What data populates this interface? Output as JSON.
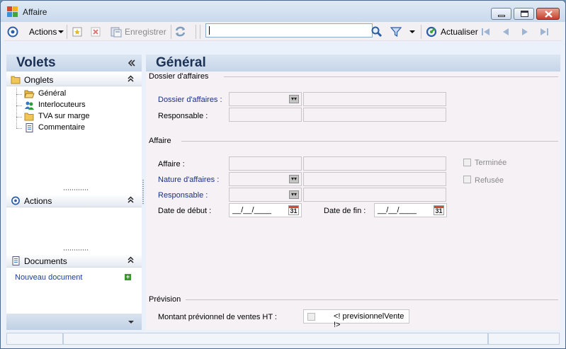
{
  "window": {
    "title": "Affaire",
    "accent": "#1c3254",
    "close_color": "#c7402a"
  },
  "toolbar": {
    "actions_label": "Actions",
    "save_label": "Enregistrer",
    "search_value": "",
    "refresh_label": "Actualiser"
  },
  "left_pane": {
    "title": "Volets",
    "tabs_section": {
      "title": "Onglets",
      "items": [
        {
          "label": "Général",
          "icon": "folder-open-icon"
        },
        {
          "label": "Interlocuteurs",
          "icon": "people-icon"
        },
        {
          "label": "TVA sur marge",
          "icon": "folder-icon"
        },
        {
          "label": "Commentaire",
          "icon": "document-icon"
        }
      ]
    },
    "actions_section": {
      "title": "Actions"
    },
    "documents_section": {
      "title": "Documents",
      "new_document_label": "Nouveau document"
    }
  },
  "main": {
    "title": "Général",
    "dossier_group": {
      "title": "Dossier d'affaires",
      "dossier_label": "Dossier d'affaires :",
      "responsable_label": "Responsable :"
    },
    "affaire_group": {
      "title": "Affaire",
      "affaire_label": "Affaire :",
      "nature_label": "Nature d'affaires :",
      "responsable_label": "Responsable :",
      "date_debut_label": "Date de début :",
      "date_debut_value": "__/__/____",
      "date_fin_label": "Date de fin :",
      "date_fin_value": "__/__/____",
      "calendar_day": "31",
      "terminee_label": "Terminée",
      "refusee_label": "Refusée"
    },
    "prevision_group": {
      "title": "Prévision",
      "montant_label": "Montant prévionnel de ventes HT :",
      "montant_value": "<! previsionnelVente !>"
    }
  }
}
